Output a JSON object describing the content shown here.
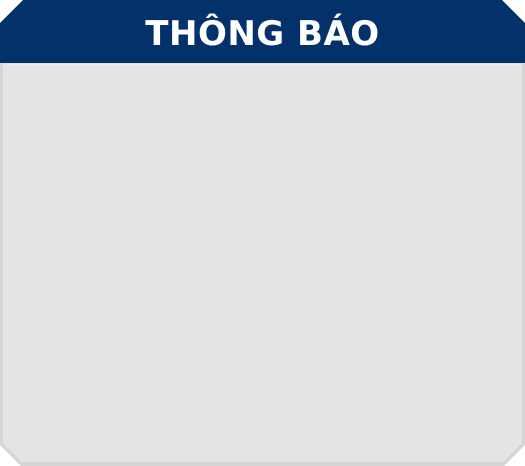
{
  "dialog": {
    "title": "THÔNG BÁO",
    "body_text": ""
  },
  "colors": {
    "header": "#03326A",
    "body": "#E4E4E4",
    "frame": "#D9D9D9",
    "title_text": "#FFFFFF"
  }
}
